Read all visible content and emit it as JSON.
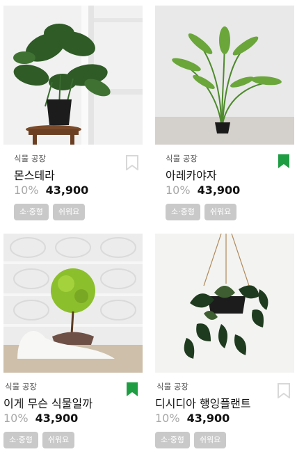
{
  "products": [
    {
      "store": "식물 공장",
      "name": "몬스테라",
      "discount": "10%",
      "price": "43,900",
      "bookmarked": false,
      "tags": [
        "소·중형",
        "쉬워요"
      ],
      "image": "monstera-plant-image"
    },
    {
      "store": "식물 공장",
      "name": "아레카야자",
      "discount": "10%",
      "price": "43,900",
      "bookmarked": true,
      "tags": [
        "소·중형",
        "쉬워요"
      ],
      "image": "areca-palm-image"
    },
    {
      "store": "식물 공장",
      "name": "이게 무슨 식물일까",
      "discount": "10%",
      "price": "43,900",
      "bookmarked": true,
      "tags": [
        "소·중형",
        "쉬워요"
      ],
      "image": "kochia-plant-image"
    },
    {
      "store": "식물 공장",
      "name": "디시디아 행잉플랜트",
      "discount": "10%",
      "price": "43,900",
      "bookmarked": false,
      "tags": [
        "소·중형",
        "쉬워요"
      ],
      "image": "dischidia-hanging-plant-image"
    }
  ],
  "colors": {
    "bookmark_active": "#1f9d43",
    "bookmark_inactive": "#d8d8d8",
    "tag_bg": "#c9c9c9"
  }
}
